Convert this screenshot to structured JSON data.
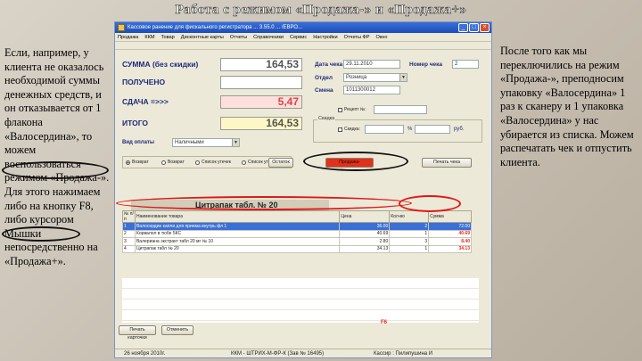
{
  "slide_title": "Работа с режимом «Продажа-» и «Продажа+»",
  "left_text": "Если, например, у клиента не оказалось необходимой суммы денежных средств, и он отказывается от 1 флакона «Валосердина», то можем воспользоваться режимом «Продажа-». Для этого нажимаем либо на кнопку F8, либо курсором Мышки непосредственно на «Продажа+».",
  "right_text": "После того как мы переключились на режим «Продажа-», преподносим упаковку «Валосердина» 1 раз к сканеру и 1 упаковка «Валосердина» у нас убирается из списка. Можем распечатать чек и отпустить клиента.",
  "window": {
    "title": "Кассовое ранение для фискального регистратора ... 3.55.0 ... /ЕВРО...",
    "menu": [
      "Продажа",
      "ККМ",
      "Товар",
      "Дисконтные карты",
      "Отчеты",
      "Справочники",
      "Сервис",
      "Настройки",
      "Отчеты ФР",
      "Окно"
    ],
    "summary": {
      "sum_label": "СУММА (без скидки)",
      "sum_value": "164,53",
      "received_label": "ПОЛУЧЕНО",
      "received_value": "",
      "change_label": "СДАЧА  =>>>",
      "change_value": "5,47",
      "total_label": "ИТОГО",
      "total_value": "164,53"
    },
    "payment_label": "Вид оплаты",
    "payment_value": "Наличными",
    "check_date_label": "Дата чека",
    "check_date_value": "29.11.2010",
    "check_no_label": "Номер чека",
    "check_no_value": "2",
    "dept_label": "Отдел",
    "dept_value": "Розница",
    "shift_label": "Смена",
    "shift_value": "1011300012",
    "receipt_label": "Рецепт №:",
    "discount_group": "Скидка",
    "discount_label": "Скидка:",
    "discount_pct": "%",
    "discount_rub": "руб.",
    "mode_radios": [
      "Возврат",
      "Возврат",
      "Список утечек",
      "Список утечек"
    ],
    "buttons": {
      "rest": "Остаток",
      "sale": "Продажа-",
      "print": "Печать чека"
    },
    "group_header": "Цитрапак табл. № 20",
    "table_headers": [
      "№ п/п",
      "Наименование товара",
      "Цена",
      "Кол-во",
      "Сумма"
    ],
    "table_rows": [
      {
        "n": "1",
        "name": "Валосердин капли для приема внутрь фл 1",
        "price": "36.00",
        "qty": "2",
        "sum": "72.00",
        "selected": true
      },
      {
        "n": "2",
        "name": "Корвалол в тюбе 5КС",
        "price": "40.69",
        "qty": "1",
        "sum": "40.69",
        "selected": false
      },
      {
        "n": "3",
        "name": "Валериана экстракт табл 20 мг № 10",
        "price": "2.80",
        "qty": "3",
        "sum": "8.40",
        "selected": false
      },
      {
        "n": "4",
        "name": "Цитрапак табл № 20",
        "price": "34.13",
        "qty": "1",
        "sum": "34.13",
        "selected": false
      }
    ],
    "f6_label": "F6",
    "bottom_buttons": [
      "Печать карточки",
      "Отменить"
    ],
    "statusbar": {
      "date": "26 ноября 2010г.",
      "kkm": "ККМ - ШТРИХ-М-ФР-К (Зав № 16495)",
      "cashier": "Кассир : Пилипушина И"
    }
  }
}
